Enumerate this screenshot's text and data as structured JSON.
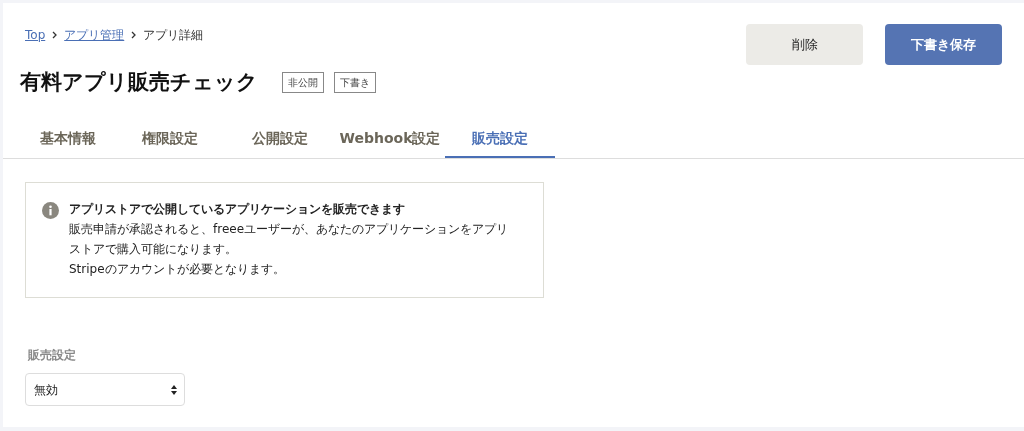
{
  "breadcrumb": [
    {
      "label": "Top",
      "link": true
    },
    {
      "label": "アプリ管理",
      "link": true
    },
    {
      "label": "アプリ詳細",
      "link": false
    }
  ],
  "title": "有料アプリ販売チェック",
  "badges": [
    "非公開",
    "下書き"
  ],
  "buttons": [
    {
      "label": "削除",
      "kind": "secondary"
    },
    {
      "label": "下書き保存",
      "kind": "primary"
    }
  ],
  "tabs": [
    {
      "label": "基本情報",
      "selected": false
    },
    {
      "label": "権限設定",
      "selected": false
    },
    {
      "label": "公開設定",
      "selected": false
    },
    {
      "label": "Webhook設定",
      "selected": false
    },
    {
      "label": "販売設定",
      "selected": true
    }
  ],
  "info": {
    "heading": "アプリストアで公開しているアプリケーションを販売できます",
    "paragraphs": [
      "販売申請が承認されると、freeeユーザーが、あなたのアプリケーションをアプリストアで購入可能になります。",
      "Stripeのアカウントが必要となります。"
    ]
  },
  "sales_setting": {
    "label": "販売設定",
    "value": "無効"
  }
}
